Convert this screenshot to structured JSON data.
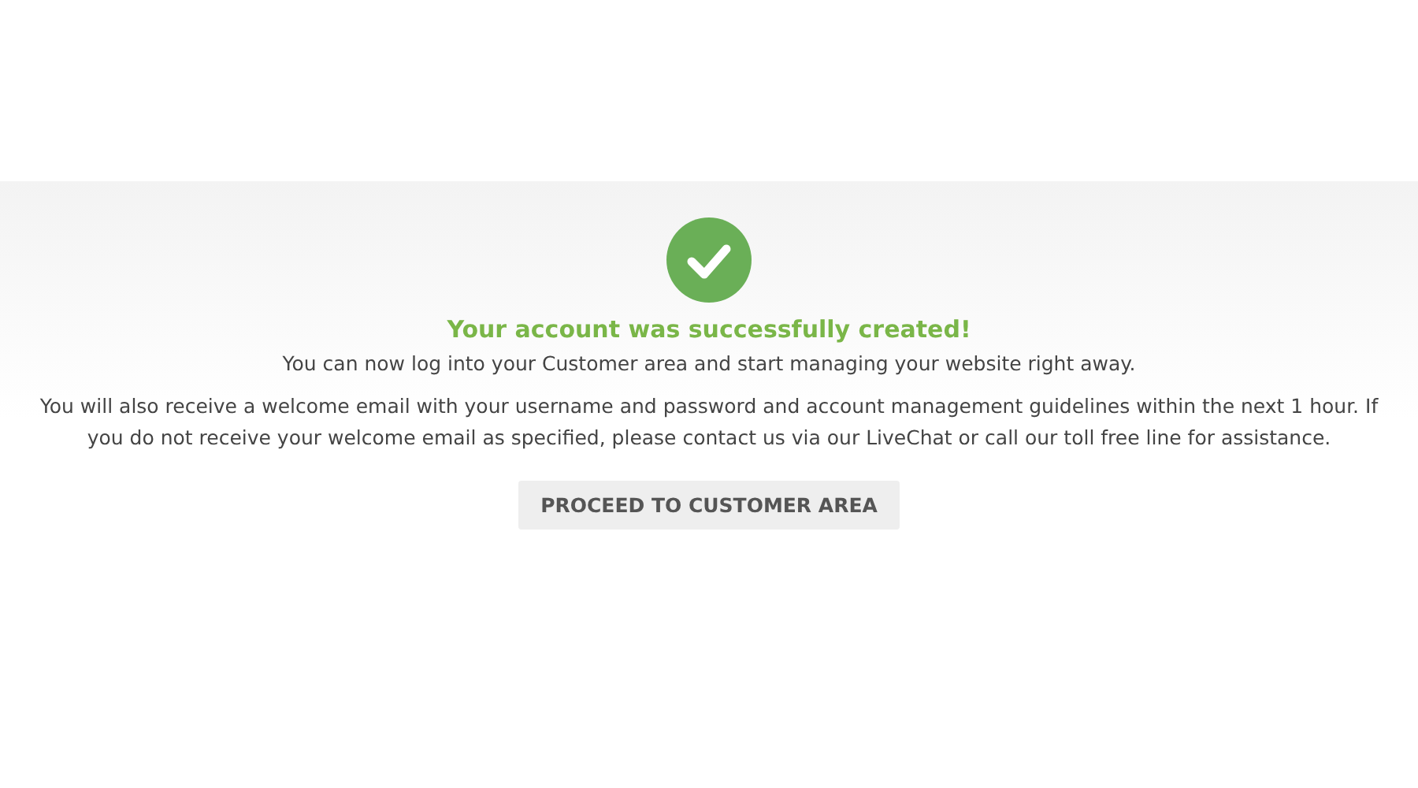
{
  "success": {
    "title": "Your account was successfully created!",
    "subtitle": "You can now log into your Customer area and start managing your website right away.",
    "message": "You will also receive a welcome email with your username and password and account management guidelines within the next 1 hour. If you do not receive your welcome email as specified, please contact us via our LiveChat or call our toll free line for assistance.",
    "button": "PROCEED TO CUSTOMER AREA"
  }
}
